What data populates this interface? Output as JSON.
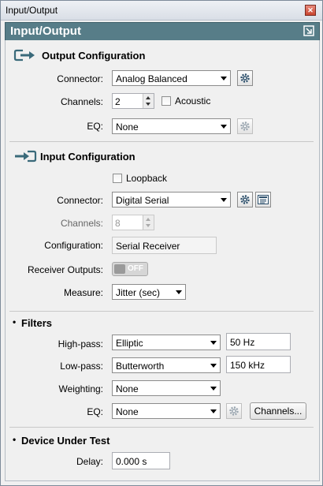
{
  "window": {
    "title": "Input/Output",
    "close_glyph": "✕"
  },
  "header": {
    "title": "Input/Output"
  },
  "output": {
    "title": "Output Configuration",
    "connector_label": "Connector:",
    "connector_value": "Analog Balanced",
    "channels_label": "Channels:",
    "channels_value": "2",
    "acoustic_label": "Acoustic",
    "eq_label": "EQ:",
    "eq_value": "None"
  },
  "input": {
    "title": "Input Configuration",
    "loopback_label": "Loopback",
    "connector_label": "Connector:",
    "connector_value": "Digital Serial",
    "channels_label": "Channels:",
    "channels_value": "8",
    "configuration_label": "Configuration:",
    "configuration_value": "Serial Receiver",
    "receiver_outputs_label": "Receiver Outputs:",
    "receiver_outputs_state": "OFF",
    "measure_label": "Measure:",
    "measure_value": "Jitter (sec)"
  },
  "filters": {
    "bullet": "•",
    "title": "Filters",
    "highpass_label": "High-pass:",
    "highpass_value": "Elliptic",
    "highpass_freq": "50 Hz",
    "lowpass_label": "Low-pass:",
    "lowpass_value": "Butterworth",
    "lowpass_freq": "150 kHz",
    "weighting_label": "Weighting:",
    "weighting_value": "None",
    "eq_label": "EQ:",
    "eq_value": "None",
    "channels_button": "Channels..."
  },
  "dut": {
    "bullet": "•",
    "title": "Device Under Test",
    "delay_label": "Delay:",
    "delay_value": "0.000 s"
  },
  "colors": {
    "header_bg": "#577d88",
    "accent": "#3a6a7a"
  }
}
